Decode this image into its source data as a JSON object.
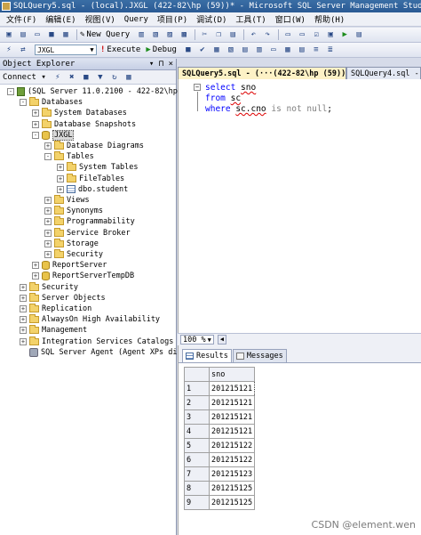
{
  "window": {
    "title": "SQLQuery5.sql - (local).JXGL (422-82\\hp (59))* - Microsoft SQL Server Management Studio"
  },
  "menu": [
    "文件(F)",
    "编辑(E)",
    "视图(V)",
    "Query",
    "项目(P)",
    "调试(D)",
    "工具(T)",
    "窗口(W)",
    "帮助(H)"
  ],
  "toolbar": {
    "new_query_label": "New Query",
    "database": "JXGL",
    "execute_label": "Execute",
    "debug_label": "Debug"
  },
  "object_explorer": {
    "title": "Object Explorer",
    "pin": "▾ ⊓ ×",
    "connect_label": "Connect ▾",
    "nodes": [
      {
        "label": "(SQL Server 11.0.2100 - 422-82\\hp)",
        "level": 0,
        "exp": "-",
        "icon": "server"
      },
      {
        "label": "Databases",
        "level": 1,
        "exp": "-",
        "icon": "folder"
      },
      {
        "label": "System Databases",
        "level": 2,
        "exp": "+",
        "icon": "folder"
      },
      {
        "label": "Database Snapshots",
        "level": 2,
        "exp": "+",
        "icon": "folder"
      },
      {
        "label": "JXGL",
        "level": 2,
        "exp": "-",
        "icon": "db",
        "selected": true
      },
      {
        "label": "Database Diagrams",
        "level": 3,
        "exp": "+",
        "icon": "folder"
      },
      {
        "label": "Tables",
        "level": 3,
        "exp": "-",
        "icon": "folder"
      },
      {
        "label": "System Tables",
        "level": 4,
        "exp": "+",
        "icon": "folder"
      },
      {
        "label": "FileTables",
        "level": 4,
        "exp": "+",
        "icon": "folder"
      },
      {
        "label": "dbo.student",
        "level": 4,
        "exp": "+",
        "icon": "table"
      },
      {
        "label": "Views",
        "level": 3,
        "exp": "+",
        "icon": "folder"
      },
      {
        "label": "Synonyms",
        "level": 3,
        "exp": "+",
        "icon": "folder"
      },
      {
        "label": "Programmability",
        "level": 3,
        "exp": "+",
        "icon": "folder"
      },
      {
        "label": "Service Broker",
        "level": 3,
        "exp": "+",
        "icon": "folder"
      },
      {
        "label": "Storage",
        "level": 3,
        "exp": "+",
        "icon": "folder"
      },
      {
        "label": "Security",
        "level": 3,
        "exp": "+",
        "icon": "folder"
      },
      {
        "label": "ReportServer",
        "level": 2,
        "exp": "+",
        "icon": "db"
      },
      {
        "label": "ReportServerTempDB",
        "level": 2,
        "exp": "+",
        "icon": "db"
      },
      {
        "label": "Security",
        "level": 1,
        "exp": "+",
        "icon": "folder"
      },
      {
        "label": "Server Objects",
        "level": 1,
        "exp": "+",
        "icon": "folder"
      },
      {
        "label": "Replication",
        "level": 1,
        "exp": "+",
        "icon": "folder"
      },
      {
        "label": "AlwaysOn High Availability",
        "level": 1,
        "exp": "+",
        "icon": "folder"
      },
      {
        "label": "Management",
        "level": 1,
        "exp": "+",
        "icon": "folder"
      },
      {
        "label": "Integration Services Catalogs",
        "level": 1,
        "exp": "+",
        "icon": "folder"
      },
      {
        "label": "SQL Server Agent (Agent XPs dis",
        "level": 1,
        "exp": "",
        "icon": "agent"
      }
    ]
  },
  "tabs": [
    {
      "label": "SQLQuery5.sql - (···(422-82\\hp (59))* ×",
      "active": true
    },
    {
      "label": "SQLQuery4.sql -",
      "active": false
    }
  ],
  "editor": {
    "lines": [
      [
        {
          "t": "select ",
          "c": "kw"
        },
        {
          "t": "sno",
          "c": "ident"
        }
      ],
      [
        {
          "t": "from ",
          "c": "kw"
        },
        {
          "t": "sc",
          "c": "ident"
        }
      ],
      [
        {
          "t": "where ",
          "c": "kw"
        },
        {
          "t": "sc.cno",
          "c": "ident"
        },
        {
          "t": " is not null",
          "c": "gray"
        },
        {
          "t": ";",
          "c": ""
        }
      ]
    ]
  },
  "zoom": "100 %",
  "results": {
    "tabs": [
      "Results",
      "Messages"
    ],
    "column": "sno",
    "rows": [
      {
        "n": "1",
        "sno": "201215121"
      },
      {
        "n": "2",
        "sno": "201215121"
      },
      {
        "n": "3",
        "sno": "201215121"
      },
      {
        "n": "4",
        "sno": "201215121"
      },
      {
        "n": "5",
        "sno": "201215122"
      },
      {
        "n": "6",
        "sno": "201215122"
      },
      {
        "n": "7",
        "sno": "201215123"
      },
      {
        "n": "8",
        "sno": "201215125"
      },
      {
        "n": "9",
        "sno": "201215125"
      }
    ]
  },
  "watermark": "CSDN @element.wen"
}
